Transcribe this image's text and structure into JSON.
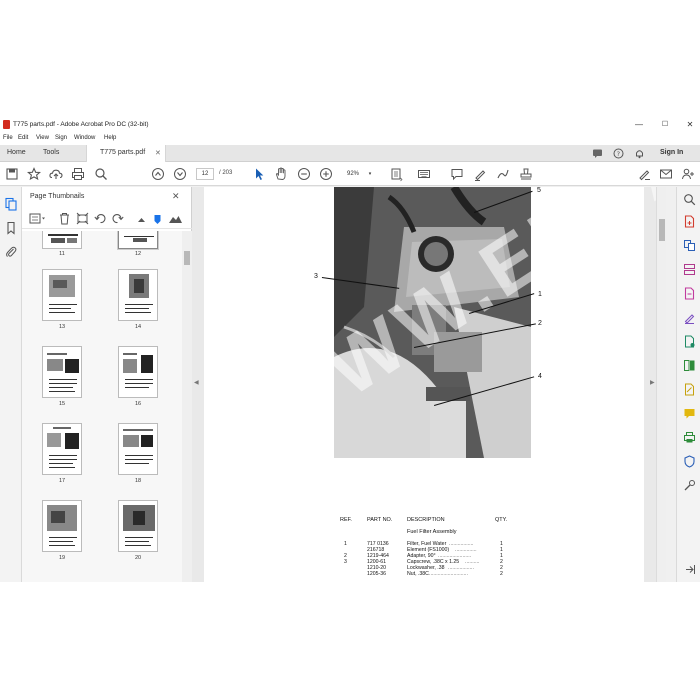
{
  "window": {
    "title": "T775 parts.pdf - Adobe Acrobat Pro DC (32-bit)",
    "minimize": "—",
    "maximize": "☐",
    "close": "✕"
  },
  "menu": [
    "File",
    "Edit",
    "View",
    "Sign",
    "Window",
    "Help"
  ],
  "tabs": {
    "home": "Home",
    "tools": "Tools",
    "document": "T775 parts.pdf",
    "close": "✕",
    "sign_in": "Sign In"
  },
  "toolbar": {
    "current_page": "12",
    "total_pages": "/ 203",
    "zoom": "92%",
    "zoom_caret": "▾"
  },
  "thumbnails_panel": {
    "title": "Page Thumbnails",
    "close": "✕",
    "pages": [
      "11",
      "12",
      "13",
      "14",
      "15",
      "16",
      "17",
      "18",
      "19",
      "20"
    ]
  },
  "document": {
    "callouts": [
      "5",
      "3",
      "1",
      "2",
      "4"
    ],
    "watermark": "WWW.EPCATS.COM",
    "parts_table": {
      "headers": [
        "REF.",
        "PART NO.",
        "DESCRIPTION",
        "QTY."
      ],
      "subtitle": "Fuel Filter Assembly",
      "rows": [
        {
          "ref": "1",
          "part": "717 0136",
          "desc": "Filter, Fuel Water",
          "qty": "1"
        },
        {
          "ref": "",
          "part": "216718",
          "desc": "Element (FS1000)",
          "qty": "1"
        },
        {
          "ref": "2",
          "part": "1219-464",
          "desc": "Adapter, 90°",
          "qty": "1"
        },
        {
          "ref": "3",
          "part": "1200-61",
          "desc": "Capscrew, .38C x 1.25",
          "qty": "2"
        },
        {
          "ref": "",
          "part": "1210-20",
          "desc": "Lockwasher, .38",
          "qty": "2"
        },
        {
          "ref": "",
          "part": "1205-36",
          "desc": "Nut, .38C",
          "qty": "2"
        }
      ]
    }
  },
  "colors": {
    "accent": "#1a73e8",
    "acrobat_red": "#d32b1e",
    "rail_bg": "#f3f3f3"
  }
}
